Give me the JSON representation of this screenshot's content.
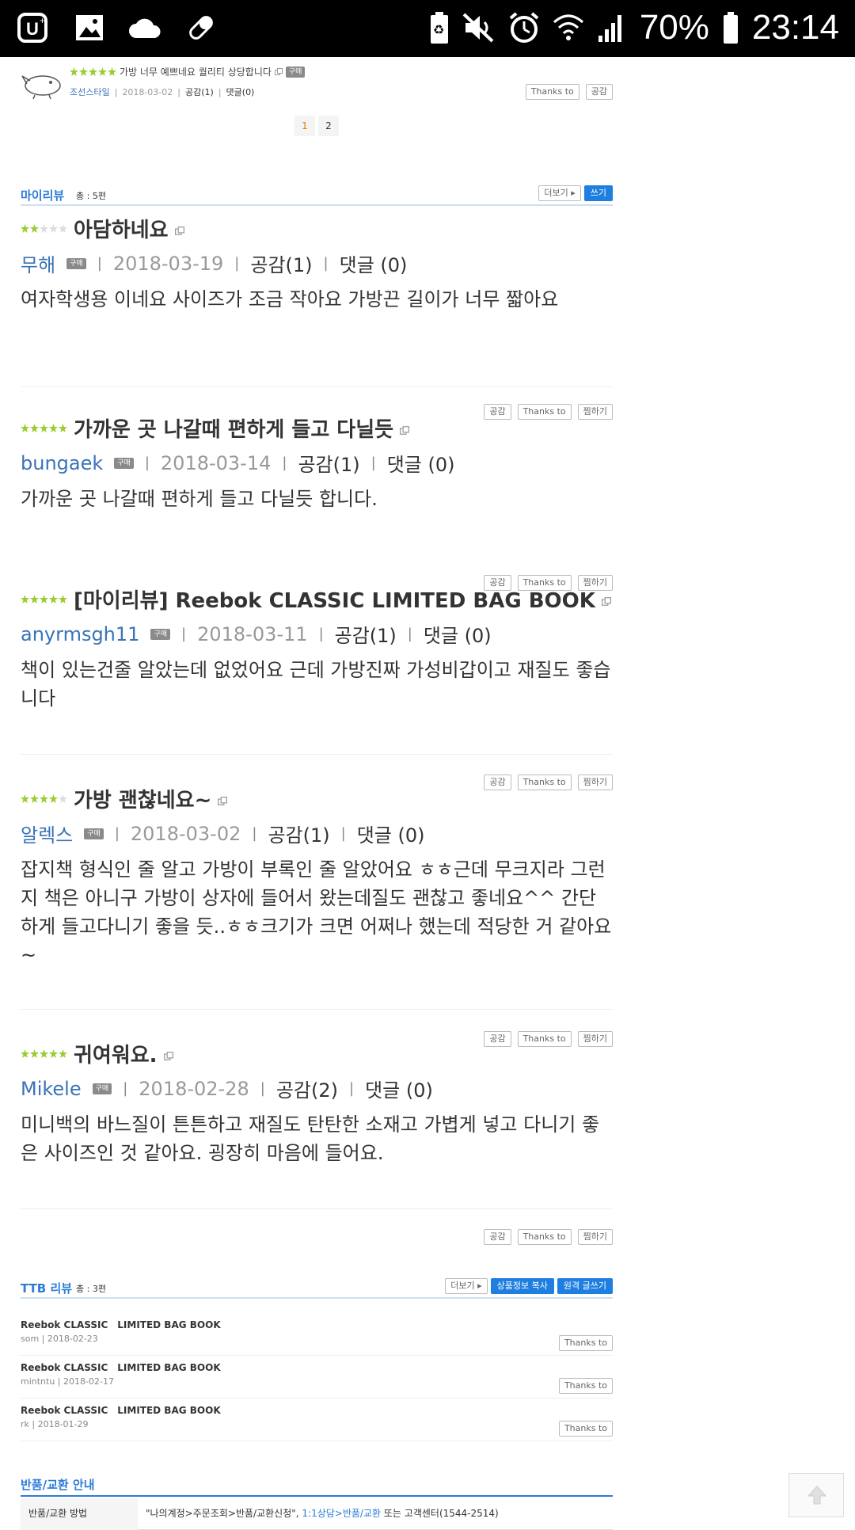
{
  "status_bar": {
    "battery": "70%",
    "time": "23:14",
    "left_icons": [
      "u-plus-icon",
      "image-icon",
      "cloud-icon",
      "pill-icon"
    ],
    "right_icons": [
      "battery-saver-icon",
      "mute-icon",
      "alarm-icon",
      "wifi-icon",
      "signal-icon",
      "battery-icon"
    ]
  },
  "top_review": {
    "title": "가방 너무 예쁘네요 퀄리티 상당합니다",
    "badge": "구매",
    "author": "조선스타일",
    "date": "2018-03-02",
    "likes": "공감(1)",
    "comments": "댓글(0)",
    "thanks_label": "Thanks to",
    "like_label": "공감",
    "rating": 5
  },
  "pagination": {
    "pages": [
      "1",
      "2"
    ],
    "active": "1"
  },
  "my_review_section": {
    "title": "마이리뷰",
    "count": "총 : 5편",
    "more_label": "더보기",
    "write_label": "쓰기"
  },
  "review_buttons": {
    "like": "공감",
    "thanks": "Thanks to",
    "scrap": "찜하기"
  },
  "reviews": [
    {
      "title": "아담하네요",
      "rating": 2,
      "author": "무해",
      "badge": "구매",
      "date": "2018-03-19",
      "likes": "공감(1)",
      "comments": "댓글 (0)",
      "body": "여자학생용 이네요 사이즈가 조금 작아요 가방끈 길이가 너무 짧아요"
    },
    {
      "title": "가까운 곳 나갈때 편하게 들고 다닐듯",
      "rating": 5,
      "author": "bungaek",
      "badge": "구매",
      "date": "2018-03-14",
      "likes": "공감(1)",
      "comments": "댓글 (0)",
      "body": "가까운 곳 나갈때 편하게 들고 다닐듯 합니다."
    },
    {
      "title": "[마이리뷰] Reebok CLASSIC LIMITED BAG BOOK",
      "rating": 5,
      "author": "anyrmsgh11",
      "badge": "구매",
      "date": "2018-03-11",
      "likes": "공감(1)",
      "comments": "댓글 (0)",
      "body": "책이 있는건줄 알았는데 없었어요 근데 가방진짜 가성비갑이고 재질도 좋습니다"
    },
    {
      "title": "가방 괜찮네요~",
      "rating": 4,
      "author": "알렉스",
      "badge": "구매",
      "date": "2018-03-02",
      "likes": "공감(1)",
      "comments": "댓글 (0)",
      "body": "잡지책 형식인 줄 알고 가방이 부록인 줄 알았어요 ㅎㅎ근데 무크지라 그런지 책은 아니구 가방이 상자에 들어서 왔는데질도 괜찮고 좋네요^^ 간단하게 들고다니기 좋을 듯..ㅎㅎ크기가 크면 어쩌나 했는데 적당한 거 같아요~"
    },
    {
      "title": "귀여워요.",
      "rating": 5,
      "author": "Mikele",
      "badge": "구매",
      "date": "2018-02-28",
      "likes": "공감(2)",
      "comments": "댓글 (0)",
      "body": "미니백의 바느질이 튼튼하고 재질도 탄탄한 소재고 가볍게 넣고 다니기 좋은 사이즈인 것 같아요. 굉장히 마음에 들어요."
    }
  ],
  "ttb_section": {
    "title": "TTB 리뷰",
    "count": "총 : 3편",
    "more_label": "더보기",
    "copy_label": "상품정보 복사",
    "write_label": "원격 글쓰기",
    "thanks_label": "Thanks to",
    "items": [
      {
        "name": "Reebok CLASSIC　LIMITED BAG BOOK",
        "sub": "som | 2018-02-23"
      },
      {
        "name": "Reebok CLASSIC　LIMITED BAG BOOK",
        "sub": "mintntu | 2018-02-17"
      },
      {
        "name": "Reebok CLASSIC　LIMITED BAG BOOK",
        "sub": "rk | 2018-01-29"
      }
    ]
  },
  "return_section": {
    "title": "반품/교환 안내",
    "row_label": "반품/교환 방법",
    "row_text_1": "\"나의계정>주문조회>반품/교환신청\",",
    "row_link": "1:1상담>반품/교환",
    "row_text_2": "또는 고객센터(1544-2514)"
  },
  "colors": {
    "accent": "#2d7bd6",
    "star": "#9acd32",
    "button_blue": "#1f7fe0"
  }
}
